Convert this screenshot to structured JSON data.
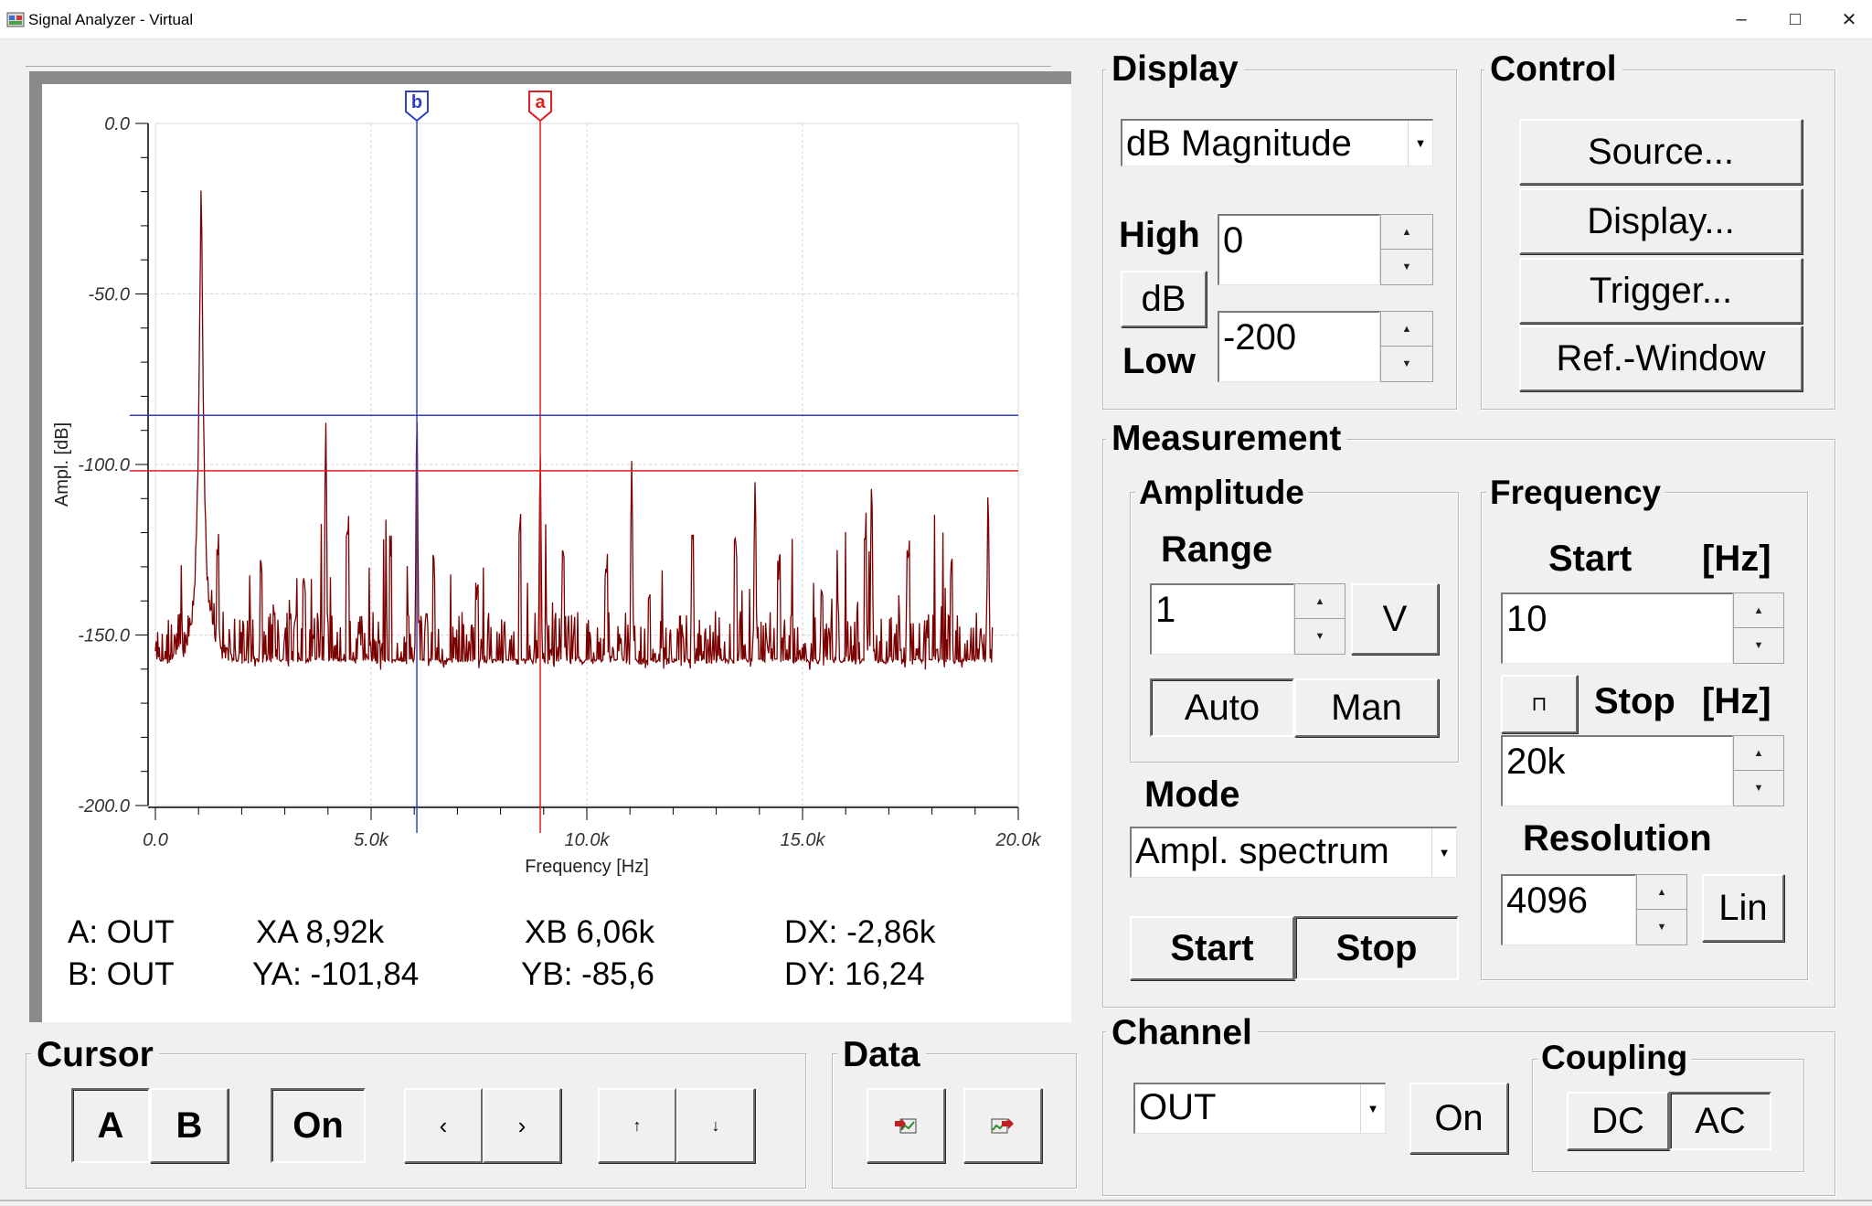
{
  "window": {
    "title": "Signal Analyzer - Virtual",
    "minimize": "–",
    "maximize": "□",
    "close": "✕"
  },
  "chart_data": {
    "type": "line",
    "title": "",
    "xlabel": "Frequency [Hz]",
    "ylabel": "Ampl. [dB]",
    "xlim": [
      0,
      20000
    ],
    "ylim": [
      -200,
      0
    ],
    "x_ticks": [
      "0.0",
      "5.0k",
      "10.0k",
      "15.0k",
      "20.0k"
    ],
    "y_ticks": [
      "0.0",
      "-50.0",
      "-100.0",
      "-150.0",
      "-200.0"
    ],
    "grid": true,
    "noise_floor_db": -160,
    "series": [
      {
        "color": "#7a0000",
        "peaks": [
          {
            "x": 1060,
            "y": -20
          },
          {
            "x": 3950,
            "y": -85
          },
          {
            "x": 6060,
            "y": -86
          },
          {
            "x": 8920,
            "y": -97
          },
          {
            "x": 11040,
            "y": -98
          },
          {
            "x": 13900,
            "y": -104
          },
          {
            "x": 16600,
            "y": -104
          },
          {
            "x": 19300,
            "y": -108
          }
        ]
      }
    ],
    "cursors": [
      {
        "name": "a",
        "x": 8920,
        "y": -101.84,
        "color": "#e02020"
      },
      {
        "name": "b",
        "x": 6060,
        "y": -85.6,
        "color": "#3040c0"
      }
    ]
  },
  "measurements": {
    "a_source": "A: OUT",
    "b_source": "B: OUT",
    "xa": "XA 8,92k",
    "ya": "YA: -101,84",
    "xb": "XB 6,06k",
    "yb": "YB: -85,6",
    "dx": "DX: -2,86k",
    "dy": "DY:  16,24"
  },
  "display": {
    "label": "Display",
    "mode": "dB Magnitude",
    "high_label": "High",
    "high_value": "0",
    "unit_button": "dB",
    "low_label": "Low",
    "low_value": "-200"
  },
  "control": {
    "label": "Control",
    "source": "Source...",
    "display": "Display...",
    "trigger": "Trigger...",
    "ref_window": "Ref.-Window"
  },
  "measurement": {
    "label": "Measurement",
    "amplitude": {
      "label": "Amplitude",
      "range_label": "Range",
      "range_value": "1",
      "unit": "V",
      "auto": "Auto",
      "man": "Man"
    },
    "mode_label": "Mode",
    "mode": "Ampl. spectrum",
    "start": "Start",
    "stop": "Stop",
    "frequency": {
      "label": "Frequency",
      "start_label": "Start",
      "hz1": "[Hz]",
      "start_value": "10",
      "lock_glyph": "⊓",
      "stop_label": "Stop",
      "hz2": "[Hz]",
      "stop_value": "20k",
      "resolution_label": "Resolution",
      "resolution_value": "4096",
      "scale": "Lin"
    }
  },
  "cursor": {
    "label": "Cursor",
    "a": "A",
    "b": "B",
    "on": "On",
    "left": "‹",
    "right": "›",
    "up": "↑",
    "down": "↓"
  },
  "data": {
    "label": "Data"
  },
  "channel": {
    "label": "Channel",
    "value": "OUT",
    "on": "On",
    "coupling_label": "Coupling",
    "dc": "DC",
    "ac": "AC"
  }
}
